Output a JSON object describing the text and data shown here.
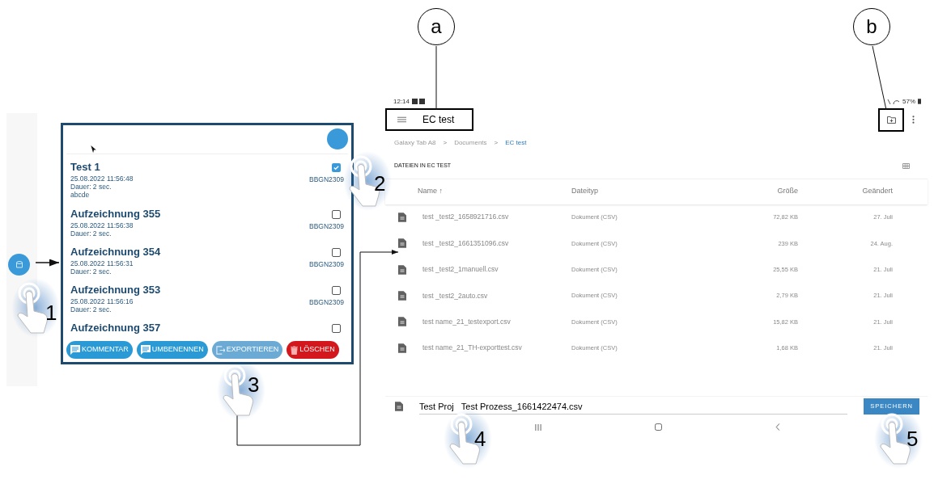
{
  "callouts": [
    {
      "label": "a"
    },
    {
      "label": "b"
    }
  ],
  "gestures": [
    {
      "number": "1"
    },
    {
      "number": "2"
    },
    {
      "number": "3"
    },
    {
      "number": "4"
    },
    {
      "number": "5"
    }
  ],
  "recordings_app": {
    "items": [
      {
        "title": "Test 1",
        "date": "25.08.2022 11:56:48",
        "duration": "Dauer: 2 sec.",
        "comment": "abcde",
        "device": "BBGN2309",
        "checked": true
      },
      {
        "title": "Aufzeichnung 355",
        "date": "25.08.2022 11:56:38",
        "duration": "Dauer: 2 sec.",
        "device": "BBGN2309",
        "checked": false
      },
      {
        "title": "Aufzeichnung 354",
        "date": "25.08.2022 11:56:31",
        "duration": "Dauer: 2 sec.",
        "device": "BBGN2309",
        "checked": false
      },
      {
        "title": "Aufzeichnung 353",
        "date": "25.08.2022 11:56:16",
        "duration": "Dauer: 2 sec.",
        "device": "BBGN2309",
        "checked": false
      },
      {
        "title": "Aufzeichnung 357",
        "checked": false
      }
    ],
    "buttons": [
      {
        "label": "KOMMENTAR",
        "kind": "comment"
      },
      {
        "label": "UMBENENNEN",
        "kind": "comment"
      },
      {
        "label": "EXPORTIEREN",
        "kind": "export"
      },
      {
        "label": "LÖSCHEN",
        "kind": "delete"
      }
    ]
  },
  "files_app": {
    "status_bar": {
      "time": "12:14",
      "battery": "57%"
    },
    "title": "EC test",
    "breadcrumb": [
      {
        "label": "Galaxy Tab A8",
        "selected": false
      },
      {
        "label": "Documents",
        "selected": false
      },
      {
        "label": "EC test",
        "selected": true
      }
    ],
    "breadcrumb_separator": ">",
    "section_title": "DATEIEN IN EC TEST",
    "columns": [
      "Name ↑",
      "Dateityp",
      "Größe",
      "Geändert"
    ],
    "rows": [
      {
        "name": "test _test2_1658921716.csv",
        "type": "Dokument (CSV)",
        "size": "72,82 KB",
        "modified": "27. Juli"
      },
      {
        "name": "test _test2_1661351096.csv",
        "type": "Dokument (CSV)",
        "size": "239 KB",
        "modified": "24. Aug."
      },
      {
        "name": "test _test2_1manuell.csv",
        "type": "Dokument (CSV)",
        "size": "25,55 KB",
        "modified": "21. Juli"
      },
      {
        "name": "test _test2_2auto.csv",
        "type": "Dokument (CSV)",
        "size": "2,79 KB",
        "modified": "21. Juli"
      },
      {
        "name": "test name_21_testexport.csv",
        "type": "Dokument (CSV)",
        "size": "15,82 KB",
        "modified": "21. Juli"
      },
      {
        "name": "test name_21_TH-exporttest.csv",
        "type": "Dokument (CSV)",
        "size": "1,68 KB",
        "modified": "21. Juli"
      }
    ],
    "filename": "Test Proj   Test Prozess_1661422474.csv",
    "save_button": "SPEICHERN"
  }
}
